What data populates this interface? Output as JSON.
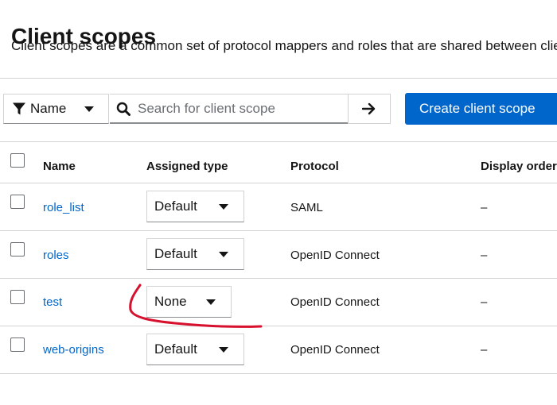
{
  "page": {
    "title": "Client scopes",
    "description": "Client scopes are a common set of protocol mappers and roles that are shared between clients"
  },
  "toolbar": {
    "filter_label": "Name",
    "search_placeholder": "Search for client scope",
    "create_label": "Create client scope"
  },
  "table": {
    "columns": [
      "Name",
      "Assigned type",
      "Protocol",
      "Display order"
    ],
    "rows": [
      {
        "name": "role_list",
        "assigned_type": "Default",
        "protocol": "SAML",
        "display_order": "–"
      },
      {
        "name": "roles",
        "assigned_type": "Default",
        "protocol": "OpenID Connect",
        "display_order": "–"
      },
      {
        "name": "test",
        "assigned_type": "None",
        "protocol": "OpenID Connect",
        "display_order": "–"
      },
      {
        "name": "web-origins",
        "assigned_type": "Default",
        "protocol": "OpenID Connect",
        "display_order": "–"
      }
    ]
  },
  "colors": {
    "primary": "#0066cc",
    "link": "#0066cc",
    "annotation": "#d6102d"
  }
}
